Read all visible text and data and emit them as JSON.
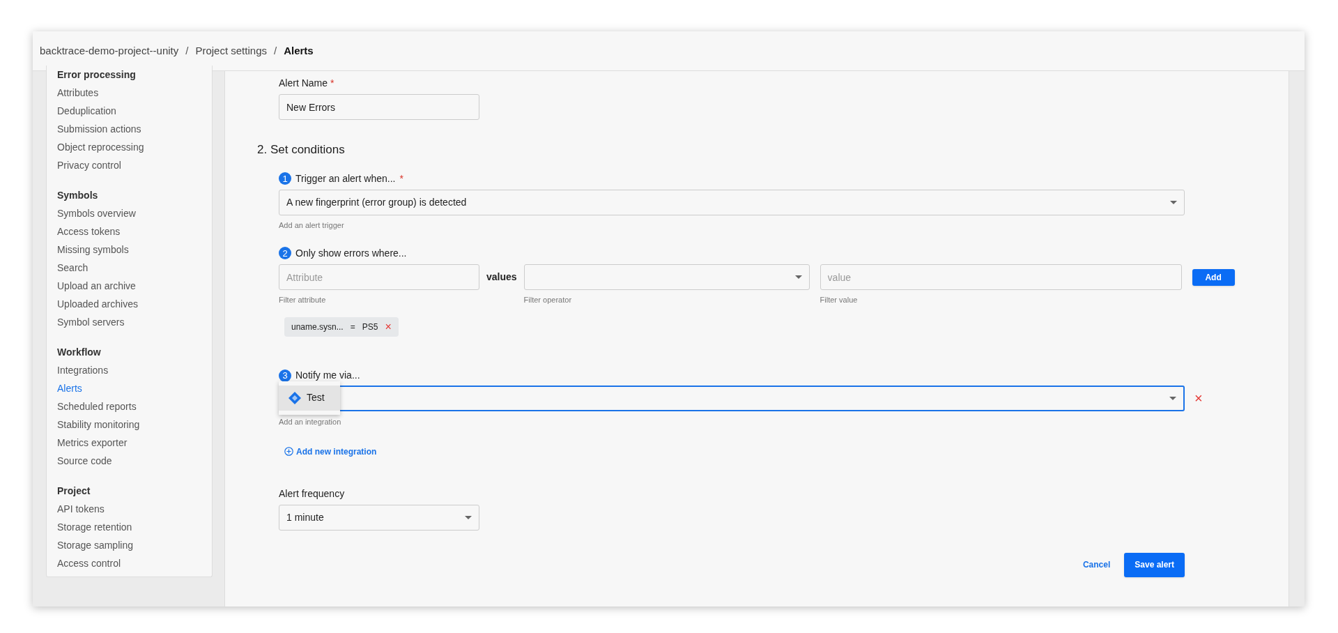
{
  "breadcrumb": [
    {
      "label": "backtrace-demo-project--unity",
      "current": false
    },
    {
      "label": "Project settings",
      "current": false
    },
    {
      "label": "Alerts",
      "current": true
    }
  ],
  "breadcrumb_separator": "/",
  "sidebar": [
    {
      "heading": "Error processing",
      "items": [
        {
          "label": "Attributes",
          "selected": false
        },
        {
          "label": "Deduplication",
          "selected": false
        },
        {
          "label": "Submission actions",
          "selected": false
        },
        {
          "label": "Object reprocessing",
          "selected": false
        },
        {
          "label": "Privacy control",
          "selected": false
        }
      ]
    },
    {
      "heading": "Symbols",
      "items": [
        {
          "label": "Symbols overview",
          "selected": false
        },
        {
          "label": "Access tokens",
          "selected": false
        },
        {
          "label": "Missing symbols",
          "selected": false
        },
        {
          "label": "Search",
          "selected": false
        },
        {
          "label": "Upload an archive",
          "selected": false
        },
        {
          "label": "Uploaded archives",
          "selected": false
        },
        {
          "label": "Symbol servers",
          "selected": false
        }
      ]
    },
    {
      "heading": "Workflow",
      "items": [
        {
          "label": "Integrations",
          "selected": false
        },
        {
          "label": "Alerts",
          "selected": true
        },
        {
          "label": "Scheduled reports",
          "selected": false
        },
        {
          "label": "Stability monitoring",
          "selected": false
        },
        {
          "label": "Metrics exporter",
          "selected": false
        },
        {
          "label": "Source code",
          "selected": false
        }
      ]
    },
    {
      "heading": "Project",
      "items": [
        {
          "label": "API tokens",
          "selected": false
        },
        {
          "label": "Storage retention",
          "selected": false
        },
        {
          "label": "Storage sampling",
          "selected": false
        },
        {
          "label": "Access control",
          "selected": false
        }
      ]
    }
  ],
  "alert_name": {
    "label": "Alert Name",
    "required_mark": "*",
    "value": "New Errors"
  },
  "section_title": "2. Set conditions",
  "trigger": {
    "step": "1",
    "label": "Trigger an alert when...",
    "required_mark": "*",
    "value": "A new fingerprint (error group) is detected",
    "helper": "Add an alert trigger"
  },
  "filter": {
    "step": "2",
    "label": "Only show errors where...",
    "attribute": {
      "placeholder": "Attribute",
      "helper": "Filter attribute"
    },
    "values_label": "values",
    "operator": {
      "helper": "Filter operator"
    },
    "value": {
      "placeholder": "value",
      "helper": "Filter value"
    },
    "add_button": "Add",
    "chips": [
      {
        "attribute": "uname.sysn...",
        "operator": "=",
        "value": "PS5",
        "remove": "×"
      }
    ]
  },
  "notify": {
    "step": "3",
    "label": "Notify me via...",
    "focused": true,
    "helper": "Add an integration",
    "remove": "×",
    "options": [
      {
        "label": "Test",
        "selected": true
      }
    ],
    "add_link": "Add new integration"
  },
  "frequency": {
    "label": "Alert frequency",
    "value": "1 minute"
  },
  "actions": {
    "cancel": "Cancel",
    "save": "Save alert"
  }
}
